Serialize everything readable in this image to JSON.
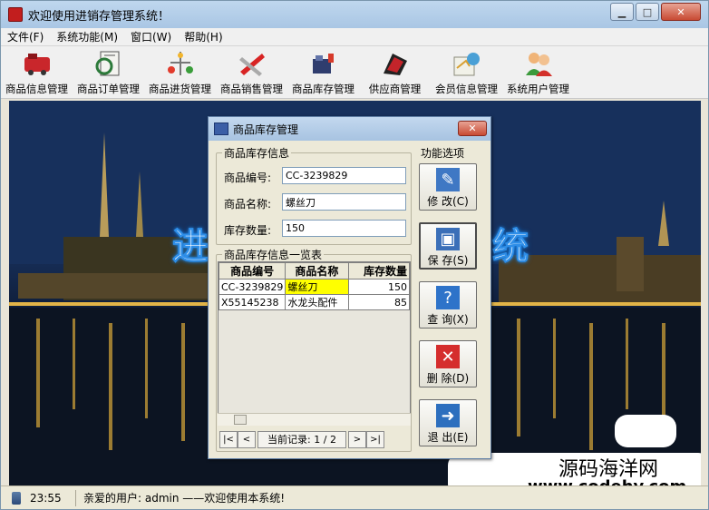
{
  "app": {
    "title": "欢迎使用进销存管理系统！"
  },
  "menu": [
    "文件(F)",
    "系统功能(M)",
    "窗口(W)",
    "帮助(H)"
  ],
  "toolbar": [
    {
      "label": "商品信息管理",
      "icon": "product-icon"
    },
    {
      "label": "商品订单管理",
      "icon": "order-icon"
    },
    {
      "label": "商品进货管理",
      "icon": "purchase-icon"
    },
    {
      "label": "商品销售管理",
      "icon": "sales-icon"
    },
    {
      "label": "商品库存管理",
      "icon": "stock-icon"
    },
    {
      "label": "供应商管理",
      "icon": "supplier-icon"
    },
    {
      "label": "会员信息管理",
      "icon": "member-icon"
    },
    {
      "label": "系统用户管理",
      "icon": "users-icon"
    }
  ],
  "banner": {
    "left": "进",
    "right": "统"
  },
  "dialog": {
    "title": "商品库存管理",
    "info_group": "商品库存信息",
    "fields": {
      "code_label": "商品编号:",
      "code_value": "CC-3239829",
      "name_label": "商品名称:",
      "name_value": "螺丝刀",
      "qty_label": "库存数量:",
      "qty_value": "150"
    },
    "list_group": "商品库存信息一览表",
    "columns": [
      "商品编号",
      "商品名称",
      "库存数量"
    ],
    "rows": [
      [
        "CC-3239829",
        "螺丝刀",
        "150"
      ],
      [
        "X55145238",
        "水龙头配件",
        "85"
      ]
    ],
    "nav": {
      "first": "|<",
      "prev": "<",
      "record": "当前记录: 1 / 2",
      "next": ">",
      "last": ">|"
    },
    "func_group": "功能选项",
    "buttons": {
      "modify": "修 改(C)",
      "save": "保 存(S)",
      "query": "查 询(X)",
      "delete": "删 除(D)",
      "exit": "退 出(E)"
    }
  },
  "status": {
    "time": "23:55",
    "message": "亲爱的用户: admin ——欢迎使用本系统!"
  },
  "watermark": {
    "cn": "源码海洋网",
    "url": "www.codehy.com"
  }
}
